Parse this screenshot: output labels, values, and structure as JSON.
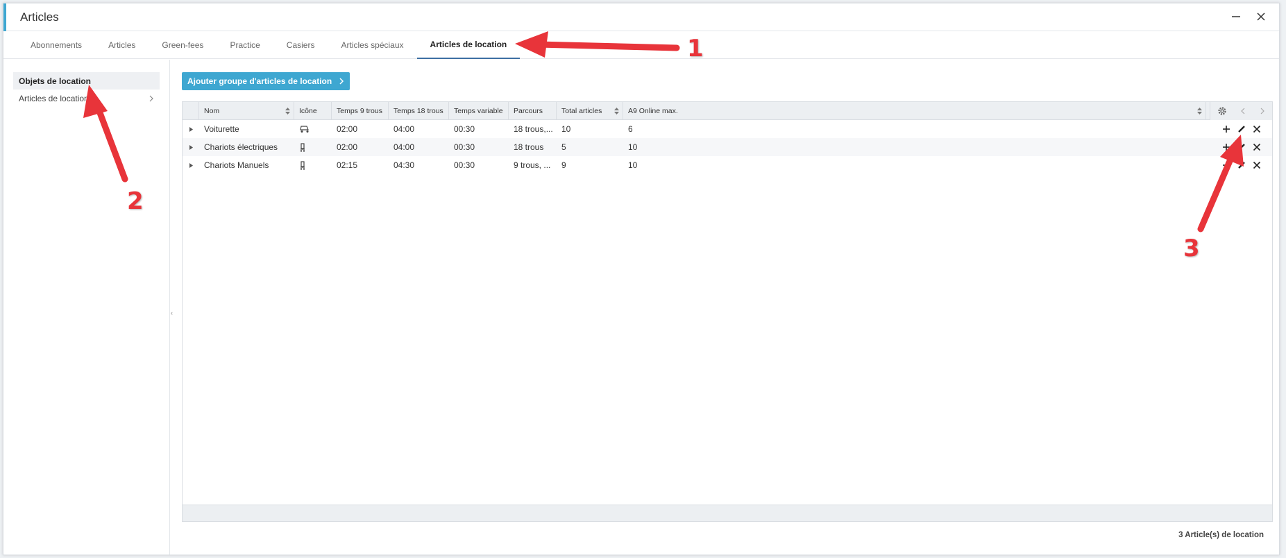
{
  "window": {
    "title": "Articles"
  },
  "tabs": [
    {
      "label": "Abonnements"
    },
    {
      "label": "Articles"
    },
    {
      "label": "Green-fees"
    },
    {
      "label": "Practice"
    },
    {
      "label": "Casiers"
    },
    {
      "label": "Articles spéciaux"
    },
    {
      "label": "Articles de location"
    }
  ],
  "sidebar": {
    "items": [
      {
        "label": "Objets de location"
      },
      {
        "label": "Articles de location"
      }
    ]
  },
  "toolbar": {
    "add_label": "Ajouter groupe d'articles de location"
  },
  "table": {
    "headers": [
      "Nom",
      "Icône",
      "Temps 9 trous",
      "Temps 18 trous",
      "Temps variable",
      "Parcours",
      "Total articles",
      "A9 Online max."
    ],
    "rows": [
      {
        "nom": "Voiturette",
        "icon": "golf-cart-icon",
        "t9": "02:00",
        "t18": "04:00",
        "tv": "00:30",
        "parcours": "18 trous,...",
        "total": "10",
        "max": "6"
      },
      {
        "nom": "Chariots électriques",
        "icon": "golf-trolley-icon",
        "t9": "02:00",
        "t18": "04:00",
        "tv": "00:30",
        "parcours": "18 trous",
        "total": "5",
        "max": "10"
      },
      {
        "nom": "Chariots Manuels",
        "icon": "golf-trolley-icon",
        "t9": "02:15",
        "t18": "04:30",
        "tv": "00:30",
        "parcours": "9 trous, ...",
        "total": "9",
        "max": "10"
      }
    ]
  },
  "status": {
    "count_label": "3 Article(s) de location"
  },
  "annotations": {
    "a1": "1",
    "a2": "2",
    "a3": "3"
  },
  "colors": {
    "accent": "#3ea7d1",
    "arrow": "#e8343a"
  }
}
